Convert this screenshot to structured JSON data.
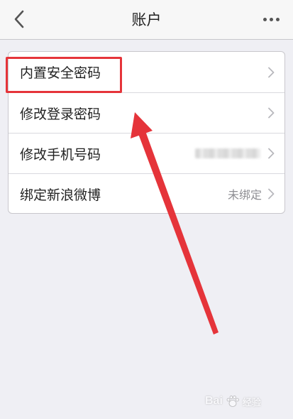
{
  "header": {
    "title": "账户",
    "back_icon": "chevron-left-icon",
    "more_icon": "more-horizontal-icon"
  },
  "settings": {
    "items": [
      {
        "label": "内置安全密码",
        "value": "",
        "icon": "chevron-right-icon"
      },
      {
        "label": "修改登录密码",
        "value": "",
        "icon": "chevron-right-icon"
      },
      {
        "label": "修改手机号码",
        "value": "",
        "masked": true,
        "icon": "chevron-right-icon"
      },
      {
        "label": "绑定新浪微博",
        "value": "未绑定",
        "icon": "chevron-right-icon"
      }
    ]
  },
  "annotation": {
    "highlight_color": "#e5343a"
  },
  "watermark": {
    "brand": "Bai",
    "suffix": "经验"
  },
  "colors": {
    "background": "#efeff4",
    "card": "#ffffff",
    "text": "#222222",
    "secondary_text": "#8e8e93",
    "accent_red": "#e5343a"
  }
}
